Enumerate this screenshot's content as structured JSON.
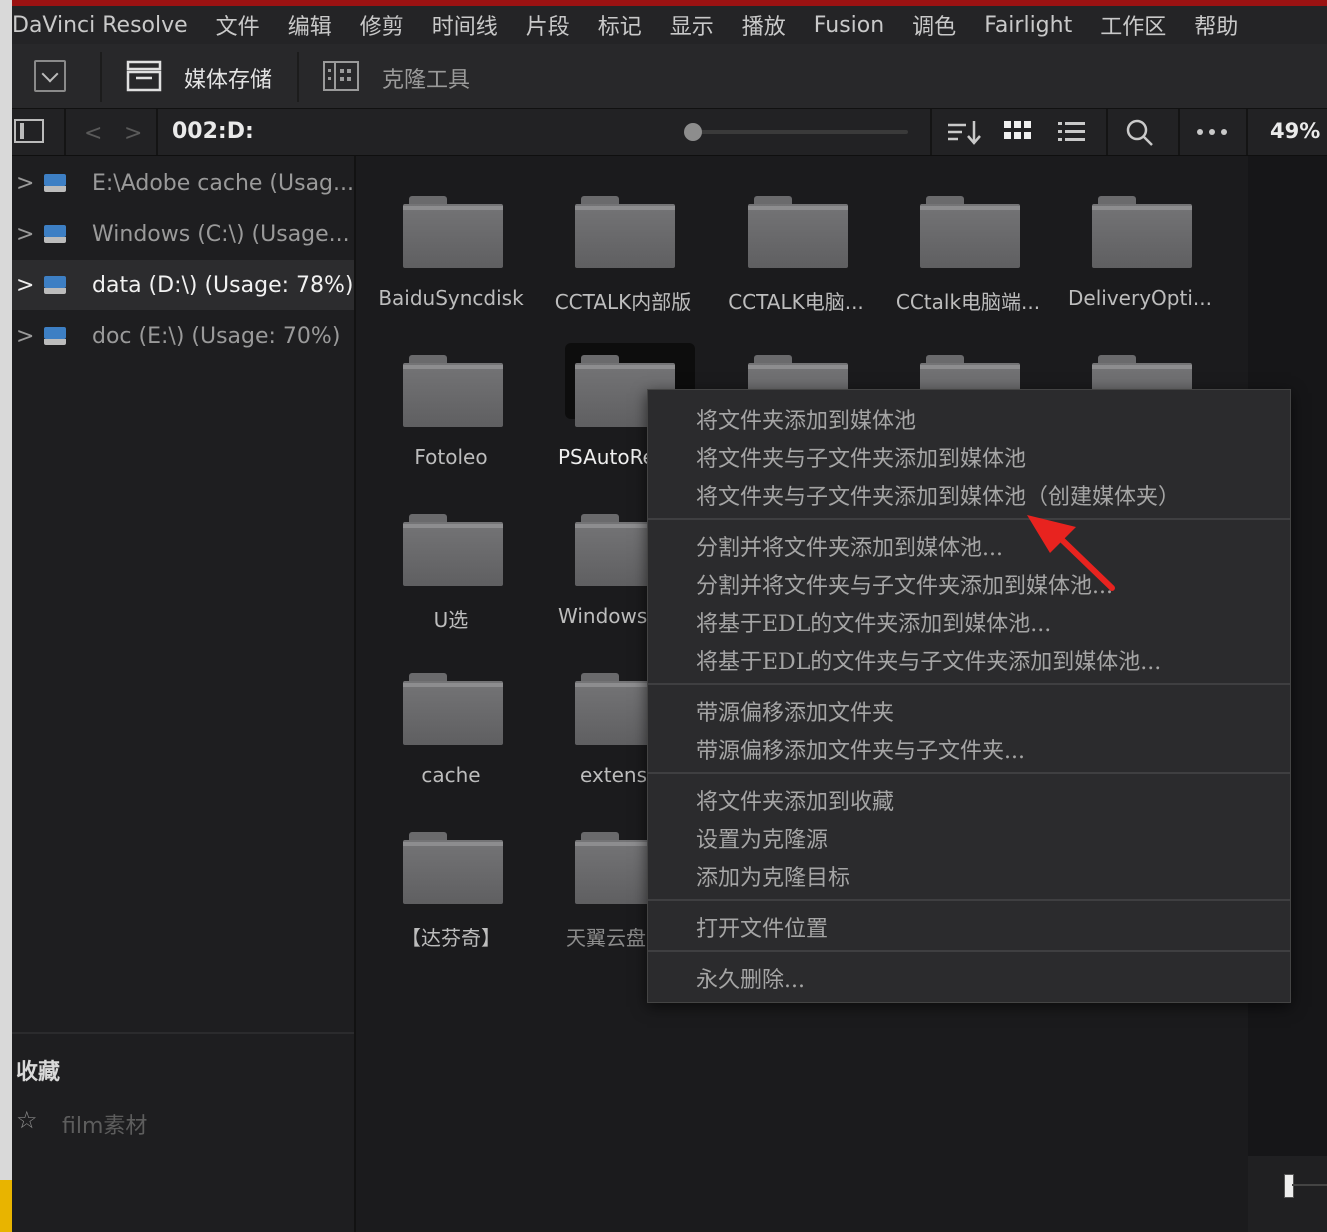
{
  "app": {
    "menu": [
      "DaVinci Resolve",
      "文件",
      "编辑",
      "修剪",
      "时间线",
      "片段",
      "标记",
      "显示",
      "播放",
      "Fusion",
      "调色",
      "Fairlight",
      "工作区",
      "帮助"
    ]
  },
  "toolbar": {
    "media_storage_label": "媒体存储",
    "clone_tool_label": "克隆工具"
  },
  "navbar": {
    "back": "<",
    "forward": ">",
    "path": "002:D:",
    "zoom": "49%"
  },
  "sidebar": {
    "drives": [
      {
        "label": "E:\\Adobe cache (Usag...",
        "selected": false
      },
      {
        "label": "Windows  (C:\\) (Usage...",
        "selected": false
      },
      {
        "label": "data (D:\\) (Usage: 78%)",
        "selected": true
      },
      {
        "label": "doc (E:\\) (Usage: 70%)",
        "selected": false
      }
    ],
    "favorites_title": "收藏",
    "favorites": [
      "film素材"
    ]
  },
  "folders": [
    "BaiduSyncdisk",
    "CCTALK内部版",
    "CCTALK电脑...",
    "CCtalk电脑端...",
    "DeliveryOpti...",
    "Fotoleo",
    "PSAutoRe",
    "",
    "",
    "",
    "U选",
    "Windows",
    "cache",
    "extens",
    "【达芬奇】",
    "天翼云盘"
  ],
  "context_menu": {
    "groups": [
      [
        "将文件夹添加到媒体池",
        "将文件夹与子文件夹添加到媒体池",
        "将文件夹与子文件夹添加到媒体池（创建媒体夹）"
      ],
      [
        "分割并将文件夹添加到媒体池...",
        "分割并将文件夹与子文件夹添加到媒体池...",
        "将基于EDL的文件夹添加到媒体池...",
        "将基于EDL的文件夹与子文件夹添加到媒体池..."
      ],
      [
        "带源偏移添加文件夹",
        "带源偏移添加文件夹与子文件夹..."
      ],
      [
        "将文件夹添加到收藏",
        "设置为克隆源",
        "添加为克隆目标"
      ],
      [
        "打开文件位置"
      ],
      [
        "永久删除..."
      ]
    ]
  },
  "colors": {
    "annotation_arrow": "#e8231f",
    "selected_drive_bg": "#2c2c2e",
    "disk_icon": "#3d7fc4"
  }
}
